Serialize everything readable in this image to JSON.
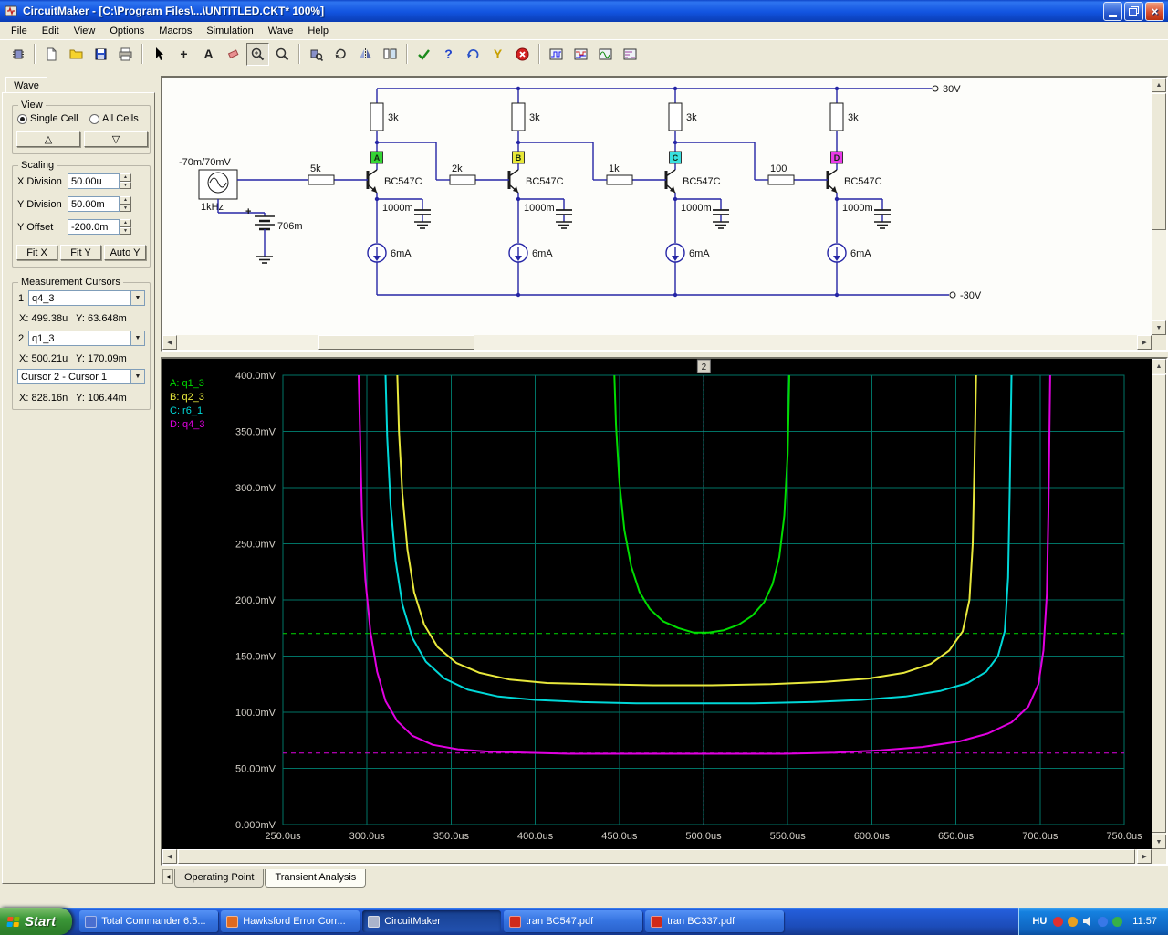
{
  "window": {
    "title": "CircuitMaker - [C:\\Program Files\\...\\UNTITLED.CKT* 100%]"
  },
  "window_controls": {
    "close_glyph": "×"
  },
  "icons": {
    "up_arrow": "▲",
    "down_arrow": "▼",
    "left_arrow": "◀",
    "right_arrow": "▶",
    "dropdown_arrow": "▼",
    "spinner_up": "▲",
    "spinner_down": "▼",
    "tab_nav": "◀"
  },
  "menu": {
    "items": [
      "File",
      "Edit",
      "View",
      "Options",
      "Macros",
      "Simulation",
      "Wave",
      "Help"
    ]
  },
  "toolbar": {
    "buttons": [
      {
        "name": "parts-browser-button",
        "icon": "chip-icon"
      },
      {
        "name": "separator"
      },
      {
        "name": "new-button",
        "icon": "new-document-icon"
      },
      {
        "name": "open-button",
        "icon": "open-folder-icon"
      },
      {
        "name": "save-button",
        "icon": "save-icon"
      },
      {
        "name": "print-button",
        "icon": "print-icon"
      },
      {
        "name": "separator"
      },
      {
        "name": "select-tool-button",
        "icon": "cursor-icon"
      },
      {
        "name": "wire-tool-button",
        "glyph": "+",
        "color": "#222222"
      },
      {
        "name": "text-tool-button",
        "glyph": "A",
        "color": "#222222"
      },
      {
        "name": "delete-tool-button",
        "icon": "eraser-icon"
      },
      {
        "name": "zoom-in-button",
        "icon": "zoom-plus-icon",
        "pressed": true
      },
      {
        "name": "zoom-tool-button",
        "icon": "zoom-icon"
      },
      {
        "name": "separator"
      },
      {
        "name": "find-device-button",
        "icon": "chip-search-icon"
      },
      {
        "name": "rotate-button",
        "icon": "rotate-icon"
      },
      {
        "name": "mirror-button",
        "icon": "mirror-icon"
      },
      {
        "name": "split-view-button",
        "icon": "panes-icon"
      },
      {
        "name": "separator"
      },
      {
        "name": "run-simulation-button",
        "icon": "check-icon"
      },
      {
        "name": "help-tool-button",
        "glyph": "?",
        "color": "#2244cc"
      },
      {
        "name": "reset-button",
        "icon": "undo-icon"
      },
      {
        "name": "wishbone-button",
        "glyph": "Y",
        "color": "#c8a000"
      },
      {
        "name": "stop-button",
        "icon": "stop-icon"
      },
      {
        "name": "separator"
      },
      {
        "name": "digital-scope-button",
        "icon": "scope1-icon"
      },
      {
        "name": "digital-options-button",
        "icon": "scope2-icon"
      },
      {
        "name": "analog-scope-button",
        "icon": "scope3-icon"
      },
      {
        "name": "analog-options-button",
        "icon": "scope4-icon"
      }
    ]
  },
  "sidebar": {
    "tab_label": "Wave",
    "view": {
      "label": "View",
      "single_cell": "Single Cell",
      "all_cells": "All Cells",
      "up_glyph": "△",
      "down_glyph": "▽"
    },
    "scaling": {
      "label": "Scaling",
      "x_division_label": "X Division",
      "x_division_value": "50.00u",
      "y_division_label": "Y Division",
      "y_division_value": "50.00m",
      "y_offset_label": "Y Offset",
      "y_offset_value": "-200.0m",
      "fit_x": "Fit X",
      "fit_y": "Fit Y",
      "auto_y": "Auto Y"
    },
    "cursors": {
      "label": "Measurement Cursors",
      "cursor1_index": "1",
      "cursor1_signal": "q4_3",
      "cursor1_readout": "X: 499.38u   Y: 63.648m",
      "cursor2_index": "2",
      "cursor2_signal": "q1_3",
      "cursor2_readout": "X: 500.21u   Y: 170.09m",
      "difference_signal": "Cursor 2 - Cursor 1",
      "difference_readout": "X: 828.16n   Y: 106.44m"
    }
  },
  "schematic": {
    "rail_top_label": "30V",
    "rail_bottom_label": "-30V",
    "source": {
      "amplitude": "-70m/70mV",
      "frequency": "1kHz",
      "offset": "706m",
      "polarity": "+"
    },
    "stages": [
      {
        "input_resistor": "5k",
        "collector_resistor": "3k",
        "transistor": "BC547C",
        "capacitor": "1000m",
        "current_source": "6mA",
        "probe": "A",
        "probe_color": "#35d435"
      },
      {
        "input_resistor": "2k",
        "collector_resistor": "3k",
        "transistor": "BC547C",
        "capacitor": "1000m",
        "current_source": "6mA",
        "probe": "B",
        "probe_color": "#e8e838"
      },
      {
        "input_resistor": "1k",
        "collector_resistor": "3k",
        "transistor": "BC547C",
        "capacitor": "1000m",
        "current_source": "6mA",
        "probe": "C",
        "probe_color": "#3ae0e0"
      },
      {
        "input_resistor": "100",
        "collector_resistor": "3k",
        "transistor": "BC547C",
        "capacitor": "1000m",
        "current_source": "6mA",
        "probe": "D",
        "probe_color": "#e83ae8"
      }
    ]
  },
  "chart_data": {
    "type": "line",
    "title": "Transient Analysis",
    "xlabel": "",
    "ylabel": "",
    "x_unit": "us",
    "y_unit": "mV",
    "xlim": [
      250,
      750
    ],
    "ylim": [
      0,
      400
    ],
    "grid": true,
    "legend_position": "top-left",
    "colors": {
      "background": "#000000",
      "grid": "#007366",
      "axis_text": "#d4d0c8"
    },
    "xticks": [
      250,
      300,
      350,
      400,
      450,
      500,
      550,
      600,
      650,
      700,
      750
    ],
    "xtick_labels": [
      "250.0us",
      "300.0us",
      "350.0us",
      "400.0us",
      "450.0us",
      "500.0us",
      "550.0us",
      "600.0us",
      "650.0us",
      "700.0us",
      "750.0us"
    ],
    "yticks": [
      0,
      50,
      100,
      150,
      200,
      250,
      300,
      350,
      400
    ],
    "ytick_labels": [
      "0.000mV",
      "50.00mV",
      "100.0mV",
      "150.0mV",
      "200.0mV",
      "250.0mV",
      "300.0mV",
      "350.0mV",
      "400.0mV"
    ],
    "series": [
      {
        "name": "q1_3",
        "label": "A: q1_3",
        "color": "#00dc00",
        "points": [
          [
            447,
            400
          ],
          [
            448,
            355
          ],
          [
            450,
            305
          ],
          [
            453,
            262
          ],
          [
            457,
            230
          ],
          [
            462,
            207
          ],
          [
            468,
            192
          ],
          [
            476,
            181
          ],
          [
            485,
            175
          ],
          [
            494,
            171
          ],
          [
            503,
            171
          ],
          [
            512,
            173
          ],
          [
            521,
            178
          ],
          [
            529,
            186
          ],
          [
            536,
            198
          ],
          [
            541,
            214
          ],
          [
            545,
            238
          ],
          [
            548,
            275
          ],
          [
            550,
            330
          ],
          [
            551,
            400
          ]
        ]
      },
      {
        "name": "q2_3",
        "label": "B: q2_3",
        "color": "#e8e83c",
        "points": [
          [
            318,
            400
          ],
          [
            319,
            350
          ],
          [
            321,
            295
          ],
          [
            324,
            245
          ],
          [
            328,
            207
          ],
          [
            334,
            178
          ],
          [
            342,
            158
          ],
          [
            353,
            144
          ],
          [
            367,
            135
          ],
          [
            385,
            129
          ],
          [
            407,
            126
          ],
          [
            435,
            125
          ],
          [
            470,
            124
          ],
          [
            505,
            124
          ],
          [
            540,
            125
          ],
          [
            572,
            127
          ],
          [
            598,
            130
          ],
          [
            619,
            135
          ],
          [
            635,
            143
          ],
          [
            646,
            155
          ],
          [
            654,
            172
          ],
          [
            658,
            200
          ],
          [
            660,
            250
          ],
          [
            661,
            320
          ],
          [
            662,
            400
          ]
        ]
      },
      {
        "name": "r6_1",
        "label": "C: r6_1",
        "color": "#00d8d8",
        "points": [
          [
            311,
            400
          ],
          [
            312,
            345
          ],
          [
            314,
            285
          ],
          [
            317,
            235
          ],
          [
            321,
            196
          ],
          [
            327,
            166
          ],
          [
            335,
            145
          ],
          [
            346,
            130
          ],
          [
            360,
            120
          ],
          [
            378,
            114
          ],
          [
            400,
            111
          ],
          [
            428,
            109
          ],
          [
            460,
            108
          ],
          [
            495,
            108
          ],
          [
            530,
            108
          ],
          [
            563,
            109
          ],
          [
            594,
            111
          ],
          [
            620,
            114
          ],
          [
            641,
            119
          ],
          [
            657,
            126
          ],
          [
            668,
            136
          ],
          [
            675,
            150
          ],
          [
            679,
            172
          ],
          [
            681,
            220
          ],
          [
            682,
            300
          ],
          [
            683,
            400
          ]
        ]
      },
      {
        "name": "q4_3",
        "label": "D: q4_3",
        "color": "#e000e0",
        "points": [
          [
            295,
            400
          ],
          [
            296,
            340
          ],
          [
            297,
            275
          ],
          [
            299,
            218
          ],
          [
            302,
            172
          ],
          [
            306,
            136
          ],
          [
            311,
            110
          ],
          [
            318,
            92
          ],
          [
            327,
            79
          ],
          [
            339,
            71
          ],
          [
            354,
            67
          ],
          [
            372,
            65
          ],
          [
            394,
            64
          ],
          [
            420,
            63
          ],
          [
            450,
            63
          ],
          [
            482,
            63
          ],
          [
            515,
            63
          ],
          [
            548,
            63
          ],
          [
            578,
            64
          ],
          [
            605,
            66
          ],
          [
            630,
            69
          ],
          [
            652,
            74
          ],
          [
            669,
            81
          ],
          [
            683,
            91
          ],
          [
            693,
            105
          ],
          [
            699,
            125
          ],
          [
            702,
            155
          ],
          [
            704,
            205
          ],
          [
            705,
            280
          ],
          [
            706,
            400
          ]
        ]
      }
    ],
    "cursor_hlines": [
      {
        "y": 170.09,
        "color": "#00dc00"
      },
      {
        "y": 63.648,
        "color": "#e000e0"
      }
    ],
    "cursor_vline": {
      "x": 500.21,
      "flag": "2",
      "color": "#ff7dff"
    }
  },
  "tabs": {
    "operating_point": "Operating Point",
    "transient_analysis": "Transient Analysis"
  },
  "taskbar": {
    "start_label": "Start",
    "tasks": [
      {
        "label": "Total Commander 6.5...",
        "icon_color": "#4a6fd0",
        "active": false
      },
      {
        "label": "Hawksford Error Corr...",
        "icon_color": "#e06a20",
        "active": false
      },
      {
        "label": "CircuitMaker",
        "icon_color": "#aab4cc",
        "active": true
      },
      {
        "label": "tran BC547.pdf",
        "icon_color": "#d02a1a",
        "active": false
      },
      {
        "label": "tran BC337.pdf",
        "icon_color": "#d02a1a",
        "active": false
      }
    ],
    "language": "HU",
    "time": "11:57",
    "tray_icons": [
      {
        "name": "antivirus-icon",
        "color": "#e03030"
      },
      {
        "name": "scheduler-icon",
        "color": "#e8a020"
      },
      {
        "name": "volume-icon",
        "color": "#f0f0f0"
      },
      {
        "name": "network-icon",
        "color": "#3878e8"
      },
      {
        "name": "messenger-icon",
        "color": "#38b048"
      }
    ]
  }
}
